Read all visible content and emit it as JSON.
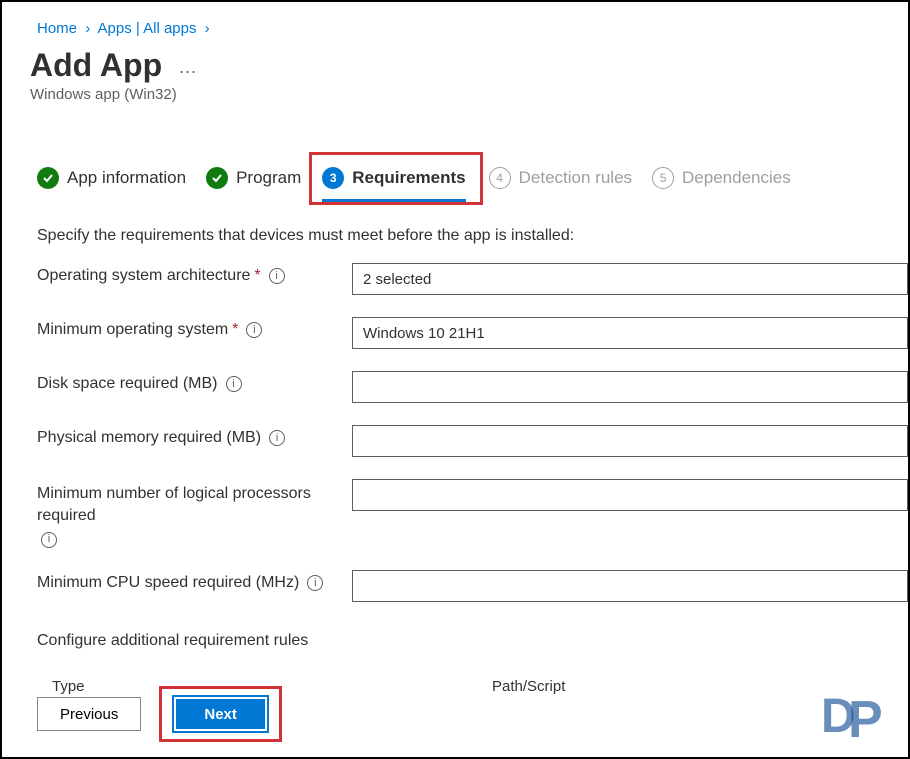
{
  "breadcrumb": {
    "home": "Home",
    "apps": "Apps | All apps"
  },
  "header": {
    "title": "Add App",
    "subtitle": "Windows app (Win32)",
    "ellipsis": "···"
  },
  "tabs": {
    "app_info": "App information",
    "program": "Program",
    "requirements": "Requirements",
    "requirements_num": "3",
    "detection": "Detection rules",
    "detection_num": "4",
    "dependencies": "Dependencies",
    "dependencies_num": "5"
  },
  "description": "Specify the requirements that devices must meet before the app is installed:",
  "form": {
    "os_arch_label": "Operating system architecture",
    "os_arch_value": "2 selected",
    "min_os_label": "Minimum operating system",
    "min_os_value": "Windows 10 21H1",
    "disk_label": "Disk space required (MB)",
    "disk_value": "",
    "memory_label": "Physical memory required (MB)",
    "memory_value": "",
    "processors_label": "Minimum number of logical processors required",
    "processors_value": "",
    "cpu_label": "Minimum CPU speed required (MHz)",
    "cpu_value": ""
  },
  "section_label": "Configure additional requirement rules",
  "table": {
    "col_type": "Type",
    "col_path": "Path/Script"
  },
  "buttons": {
    "previous": "Previous",
    "next": "Next"
  }
}
